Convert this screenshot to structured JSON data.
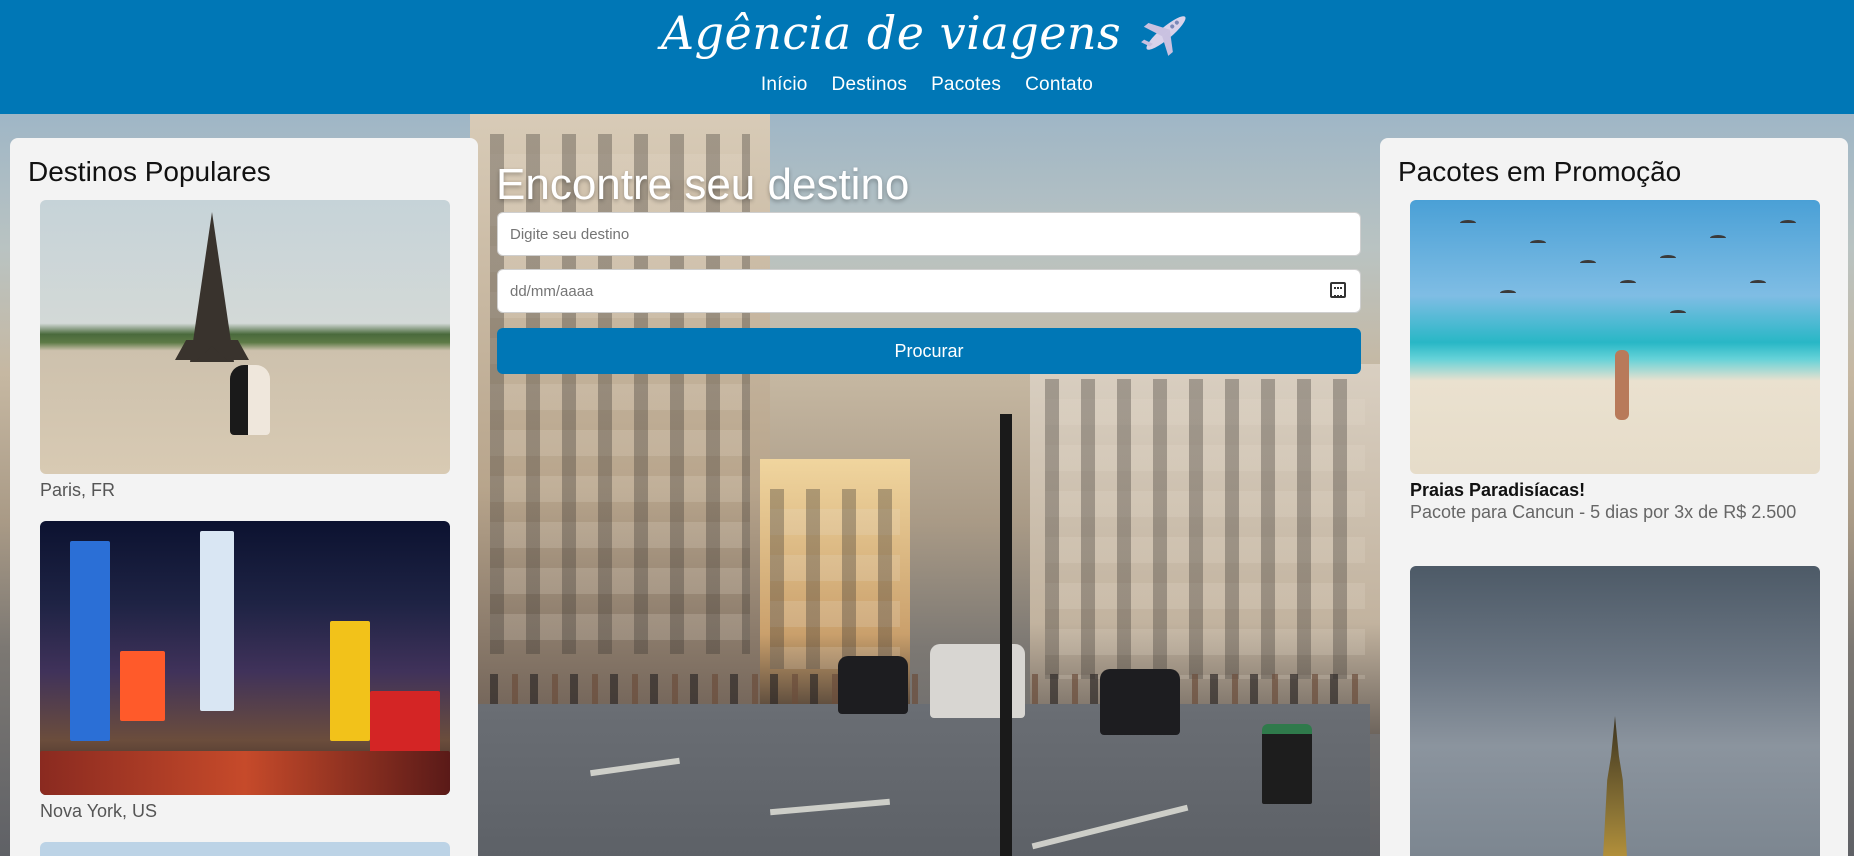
{
  "header": {
    "title": "Agência de viagens",
    "nav": [
      "Início",
      "Destinos",
      "Pacotes",
      "Contato"
    ]
  },
  "left_panel": {
    "title": "Destinos Populares",
    "items": [
      {
        "caption": "Paris, FR",
        "image": "eiffel-tower-photo"
      },
      {
        "caption": "Nova York, US",
        "image": "times-square-photo"
      }
    ]
  },
  "search": {
    "title": "Encontre seu destino",
    "destination_placeholder": "Digite seu destino",
    "date_placeholder": "dd/mm/aaaa",
    "button_label": "Procurar"
  },
  "right_panel": {
    "title": "Pacotes em Promoção",
    "items": [
      {
        "title": "Praias Paradisíacas!",
        "description": "Pacote para Cancun - 5 dias por 3x de R$ 2.500",
        "image": "beach-photo"
      },
      {
        "image": "big-ben-photo"
      }
    ]
  },
  "colors": {
    "header_bg": "#0077b6",
    "button_bg": "#0077b6",
    "panel_bg": "#f3f3f3"
  }
}
